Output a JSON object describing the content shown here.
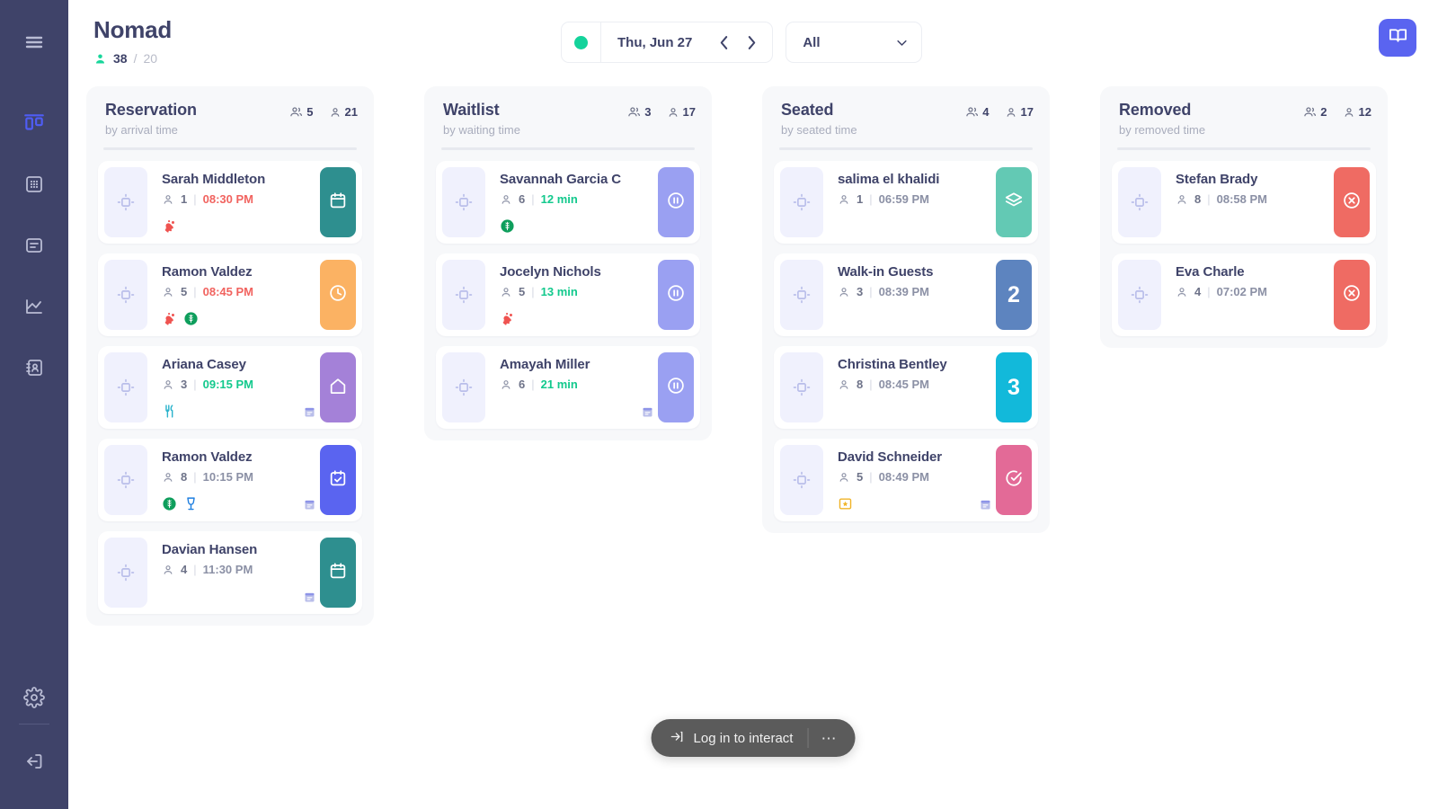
{
  "sidebar": {
    "items": [
      {
        "name": "menu-toggle",
        "icon": "hamburger-menu-icon",
        "active": false
      },
      {
        "name": "board",
        "icon": "kanban-board-icon",
        "active": true
      },
      {
        "name": "floorplan",
        "icon": "grid-icon",
        "active": false
      },
      {
        "name": "reports",
        "icon": "report-icon",
        "active": false
      },
      {
        "name": "analytics",
        "icon": "line-chart-icon",
        "active": false
      },
      {
        "name": "contacts",
        "icon": "contact-book-icon",
        "active": false
      }
    ],
    "bottom": [
      {
        "name": "settings",
        "icon": "gear-icon"
      },
      {
        "name": "logout",
        "icon": "logout-icon"
      }
    ]
  },
  "header": {
    "title": "Nomad",
    "covers_current": "38",
    "covers_separator": "/",
    "covers_max": "20",
    "status_indicator": "open",
    "date_label": "Thu, Jun 27",
    "prev_label": "‹",
    "next_label": "›",
    "filter_value": "All",
    "book_button": "reservation-book-icon",
    "accent_color": "#5a64f0",
    "status_color": "#14d39b"
  },
  "columns": [
    {
      "title": "Reservation",
      "subtitle": "by arrival time",
      "parties": "5",
      "guests": "21",
      "cards": [
        {
          "name": "Sarah Middleton",
          "pax": "1",
          "time": "08:30 PM",
          "time_state": "red",
          "action_icon": "calendar-icon",
          "action_color": "#2e8f8f",
          "badges": [
            "allergy-icon"
          ],
          "note": false
        },
        {
          "name": "Ramon Valdez",
          "pax": "5",
          "time": "08:45 PM",
          "time_state": "red",
          "action_icon": "clock-icon",
          "action_color": "#fbb263",
          "badges": [
            "allergy-icon",
            "gluten-free-icon"
          ],
          "note": false
        },
        {
          "name": "Ariana Casey",
          "pax": "3",
          "time": "09:15 PM",
          "time_state": "green",
          "action_icon": "home-icon",
          "action_color": "#a481d8",
          "badges": [
            "cutlery-icon"
          ],
          "note": true
        },
        {
          "name": "Ramon Valdez",
          "pax": "8",
          "time": "10:15 PM",
          "time_state": "grey",
          "action_icon": "calendar-check-icon",
          "action_color": "#5a64f0",
          "badges": [
            "gluten-free-icon",
            "wine-glass-icon"
          ],
          "note": true
        },
        {
          "name": "Davian Hansen",
          "pax": "4",
          "time": "11:30 PM",
          "time_state": "grey",
          "action_icon": "calendar-icon",
          "action_color": "#2e8f8f",
          "badges": [],
          "note": true
        }
      ]
    },
    {
      "title": "Waitlist",
      "subtitle": "by waiting time",
      "parties": "3",
      "guests": "17",
      "cards": [
        {
          "name": "Savannah Garcia C",
          "pax": "6",
          "time": "12 min",
          "time_state": "green",
          "action_icon": "pause-icon",
          "action_color": "#9aa0f2",
          "badges": [
            "gluten-free-icon"
          ],
          "note": false
        },
        {
          "name": "Jocelyn Nichols",
          "pax": "5",
          "time": "13 min",
          "time_state": "green",
          "action_icon": "pause-icon",
          "action_color": "#9aa0f2",
          "badges": [
            "allergy-icon"
          ],
          "note": false
        },
        {
          "name": "Amayah Miller",
          "pax": "6",
          "time": "21 min",
          "time_state": "green",
          "action_icon": "pause-icon",
          "action_color": "#9aa0f2",
          "badges": [],
          "note": true
        }
      ]
    },
    {
      "title": "Seated",
      "subtitle": "by seated time",
      "parties": "4",
      "guests": "17",
      "cards": [
        {
          "name": "salima el khalidi",
          "pax": "1",
          "time": "06:59 PM",
          "time_state": "grey",
          "action_icon": "layers-icon",
          "action_color": "#63c9b4",
          "badges": [],
          "note": false
        },
        {
          "name": "Walk-in Guests",
          "pax": "3",
          "time": "08:39 PM",
          "time_state": "grey",
          "action_icon": "table-number",
          "action_label": "2",
          "action_color": "#5d84bf",
          "badges": [],
          "note": false
        },
        {
          "name": "Christina Bentley",
          "pax": "8",
          "time": "08:45 PM",
          "time_state": "grey",
          "action_icon": "table-number",
          "action_label": "3",
          "action_color": "#12b9da",
          "badges": [],
          "note": false
        },
        {
          "name": "David Schneider",
          "pax": "5",
          "time": "08:49 PM",
          "time_state": "grey",
          "action_icon": "check-circle-icon",
          "action_color": "#e36a97",
          "badges": [
            "special-occasion-icon"
          ],
          "note": true
        }
      ]
    },
    {
      "title": "Removed",
      "subtitle": "by removed time",
      "parties": "2",
      "guests": "12",
      "cards": [
        {
          "name": "Stefan Brady",
          "pax": "8",
          "time": "08:58 PM",
          "time_state": "grey",
          "action_icon": "cancel-circle-icon",
          "action_color": "#ef6b63",
          "badges": [],
          "note": false
        },
        {
          "name": "Eva Charle",
          "pax": "4",
          "time": "07:02 PM",
          "time_state": "grey",
          "action_icon": "cancel-circle-icon",
          "action_color": "#ef6b63",
          "badges": [],
          "note": false
        }
      ]
    }
  ],
  "login_bar": {
    "label": "Log in to interact",
    "icon": "login-arrow-icon",
    "more": "⋯"
  }
}
